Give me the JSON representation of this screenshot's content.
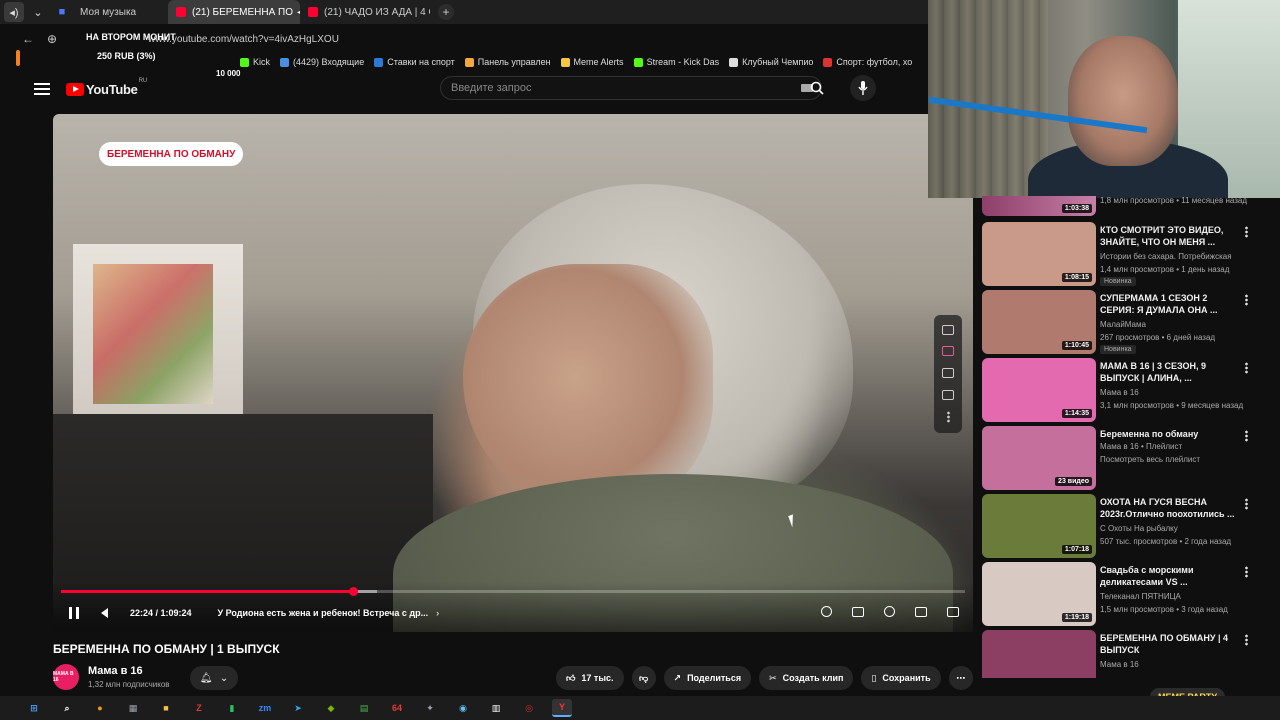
{
  "browser": {
    "tabs": [
      {
        "label": "Моя музыка",
        "active": false
      },
      {
        "label": "(21) БЕРЕМЕННА ПО",
        "active": true
      },
      {
        "label": "(21) ЧАДО ИЗ АДА | 4 СЕ",
        "active": false
      }
    ],
    "url": "www.youtube.com/watch?v=4ivAzHgLXOU",
    "bookmarks": [
      {
        "label": "Kick",
        "color": "#53fc18"
      },
      {
        "label": "(4429) Входящие",
        "color": "#4a90e2"
      },
      {
        "label": "Ставки на спорт",
        "color": "#2a7bd6"
      },
      {
        "label": "Панель управлен",
        "color": "#f2a93b"
      },
      {
        "label": "Meme Alerts",
        "color": "#f5c842"
      },
      {
        "label": "Stream - Kick Das",
        "color": "#53fc18"
      },
      {
        "label": "Клубный Чемпио",
        "color": "#dddddd"
      },
      {
        "label": "Спорт: футбол, хо",
        "color": "#d33"
      }
    ]
  },
  "stream_overlay": {
    "monitor_text": "НА ВТОРОМ МОНИТ",
    "donation": "250 RUB (3%)",
    "goal": "10 000"
  },
  "youtube": {
    "logo_text": "YouTube",
    "logo_region": "RU",
    "search_placeholder": "Введите запрос"
  },
  "video": {
    "badge": "БЕРЕМЕННА ПО ОБМАНУ",
    "time": "22:24 / 1:09:24",
    "chapter": "У Родиона есть жена и ребенок! Встреча с др...",
    "progress": 0.323,
    "buffered": 0.35,
    "title": "БЕРЕМЕННА ПО ОБМАНУ | 1 ВЫПУСК",
    "channel": "Мама в 16",
    "channel_avatar_text": "МАМА В 16",
    "subscribers": "1,32 млн подписчиков",
    "likes": "17 тыс.",
    "share_label": "Поделиться",
    "clip_label": "Создать клип",
    "save_label": "Сохранить"
  },
  "recommendations_top": {
    "duration": "1:03:38",
    "meta": "1,8 млн просмотров • 11 месяцев назад"
  },
  "recommendations": [
    {
      "title": "КТО СМОТРИТ ЭТО ВИДЕО, ЗНАЙТЕ, ЧТО ОН МЕНЯ ...",
      "channel": "Истории без сахара. Потребижская",
      "meta": "1,4 млн просмотров • 1 день назад",
      "badge": "Новинка",
      "duration": "1:08:15",
      "thumb": "#c99a8a"
    },
    {
      "title": "СУПЕРМАМА 1 СЕЗОН 2 СЕРИЯ: Я ДУМАЛА ОНА ...",
      "channel": "МалайМама",
      "meta": "267 просмотров • 6 дней назад",
      "badge": "Новинка",
      "duration": "1:10:45",
      "thumb": "#b07a6f"
    },
    {
      "title": "МАМА В 16 | 3 СЕЗОН, 9 ВЫПУСК | АЛИНА, ...",
      "channel": "Мама в 16",
      "meta": "3,1 млн просмотров • 9 месяцев назад",
      "badge": "",
      "duration": "1:14:35",
      "thumb": "#e46ab0"
    },
    {
      "title": "Беременна по обману",
      "channel": "Мама в 16 • Плейлист",
      "meta": "Посмотреть весь плейлист",
      "badge": "",
      "duration": "23 видео",
      "thumb": "#c46f9c"
    },
    {
      "title": "ОХОТА НА ГУСЯ ВЕСНА 2023г.Отлично поохотились ...",
      "channel": "С Охоты На рыбалку",
      "meta": "507 тыс. просмотров • 2 года назад",
      "badge": "",
      "duration": "1:07:18",
      "thumb": "#6b7b3a"
    },
    {
      "title": "Свадьба с морскими деликатесами VS ...",
      "channel": "Телеканал ПЯТНИЦА",
      "meta": "1,5 млн просмотров • 3 года назад",
      "badge": "",
      "duration": "1:19:18",
      "thumb": "#d8c9c2"
    },
    {
      "title": "БЕРЕМЕННА ПО ОБМАНУ | 4 ВЫПУСК",
      "channel": "Мама в 16",
      "meta": "",
      "badge": "",
      "duration": "",
      "thumb": "#8d3f63"
    }
  ],
  "meme_party": "MEME PARTY",
  "taskbar": [
    {
      "icon": "windows-icon",
      "label": "⊞",
      "color": "#4aa3ff"
    },
    {
      "icon": "search-icon",
      "label": "⌕",
      "color": "#ffffff"
    },
    {
      "icon": "browser-icon",
      "label": "●",
      "color": "#f59e0b"
    },
    {
      "icon": "calculator-icon",
      "label": "▦",
      "color": "#9ca3af"
    },
    {
      "icon": "folder-icon",
      "label": "■",
      "color": "#f5c542"
    },
    {
      "icon": "z-app-icon",
      "label": "Z",
      "color": "#e53935"
    },
    {
      "icon": "battery-app-icon",
      "label": "▮",
      "color": "#22c55e"
    },
    {
      "icon": "zoom-icon",
      "label": "zm",
      "color": "#2d8cff"
    },
    {
      "icon": "telegram-icon",
      "label": "➤",
      "color": "#2aabee"
    },
    {
      "icon": "nvidia-icon",
      "label": "◆",
      "color": "#76b900"
    },
    {
      "icon": "green-app-icon",
      "label": "▤",
      "color": "#4caf50"
    },
    {
      "icon": "64-app-icon",
      "label": "64",
      "color": "#e53935"
    },
    {
      "icon": "gear-app-icon",
      "label": "✦",
      "color": "#9ca3af"
    },
    {
      "icon": "steam-icon",
      "label": "◉",
      "color": "#66c0f4"
    },
    {
      "icon": "hdd-app-icon",
      "label": "▥",
      "color": "#ffffff"
    },
    {
      "icon": "obs-icon",
      "label": "◎",
      "color": "#d32f2f"
    },
    {
      "icon": "yandex-browser-icon",
      "label": "Y",
      "color": "#ff3333"
    }
  ]
}
